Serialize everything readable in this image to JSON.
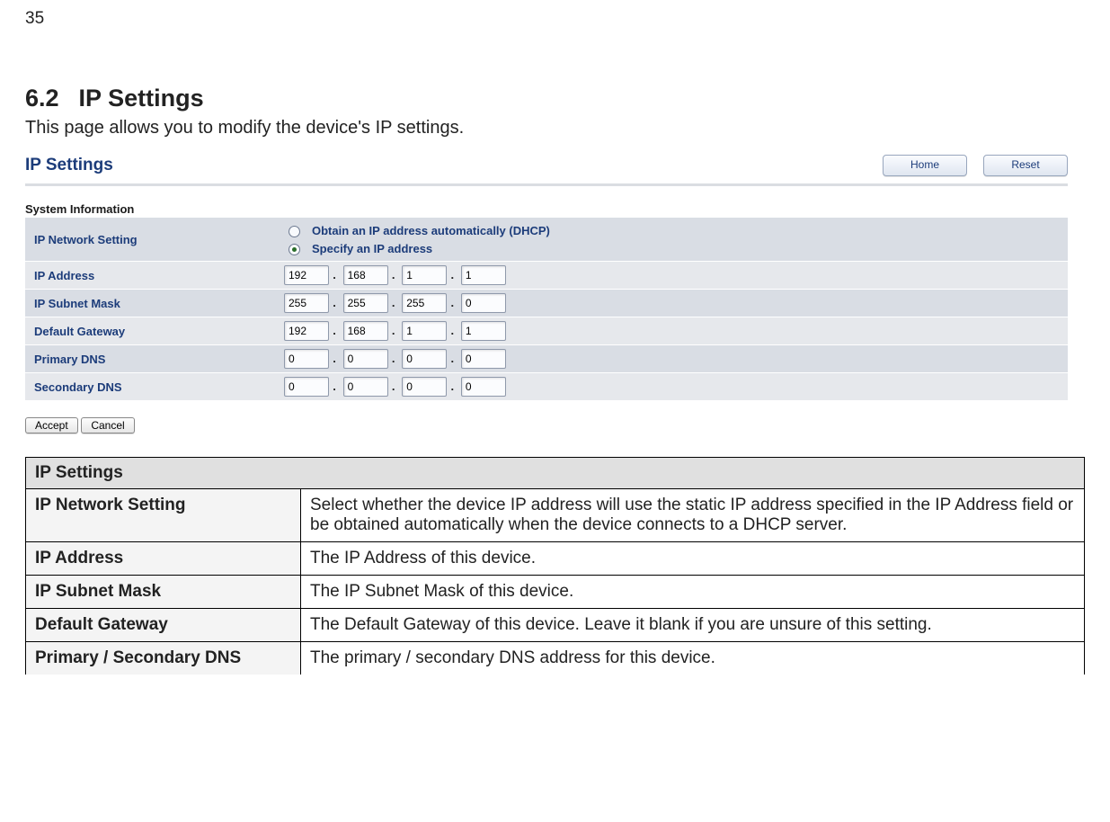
{
  "page_number": "35",
  "section": {
    "number": "6.2",
    "title": "IP Settings"
  },
  "intro": "This page allows you to modify the device's IP settings.",
  "panel": {
    "title": "IP Settings",
    "nav": {
      "home": "Home",
      "reset": "Reset"
    },
    "subhead": "System Information",
    "rows": {
      "network_setting_label": "IP Network Setting",
      "radio_dhcp": "Obtain an IP address automatically (DHCP)",
      "radio_static": "Specify an IP address",
      "ip_address_label": "IP Address",
      "ip_address": [
        "192",
        "168",
        "1",
        "1"
      ],
      "subnet_label": "IP  Subnet Mask",
      "subnet": [
        "255",
        "255",
        "255",
        "0"
      ],
      "gateway_label": "Default Gateway",
      "gateway": [
        "192",
        "168",
        "1",
        "1"
      ],
      "pdns_label": "Primary DNS",
      "pdns": [
        "0",
        "0",
        "0",
        "0"
      ],
      "sdns_label": "Secondary DNS",
      "sdns": [
        "0",
        "0",
        "0",
        "0"
      ]
    },
    "buttons": {
      "accept": "Accept",
      "cancel": "Cancel"
    }
  },
  "doc_table": {
    "banner": "IP Settings",
    "rows": [
      {
        "term": "IP Network Setting",
        "desc": "Select whether the device IP address will use the static IP address specified in the IP Address field or be obtained automatically when the device connects to a DHCP server."
      },
      {
        "term": "IP Address",
        "desc": "The IP Address of this device."
      },
      {
        "term": "IP Subnet Mask",
        "desc": "The IP Subnet Mask of this device."
      },
      {
        "term": "Default Gateway",
        "desc": "The Default Gateway of this device. Leave it blank if you are unsure of this setting."
      },
      {
        "term": "Primary / Secondary DNS",
        "desc": "The primary / secondary DNS address for this device."
      }
    ]
  }
}
